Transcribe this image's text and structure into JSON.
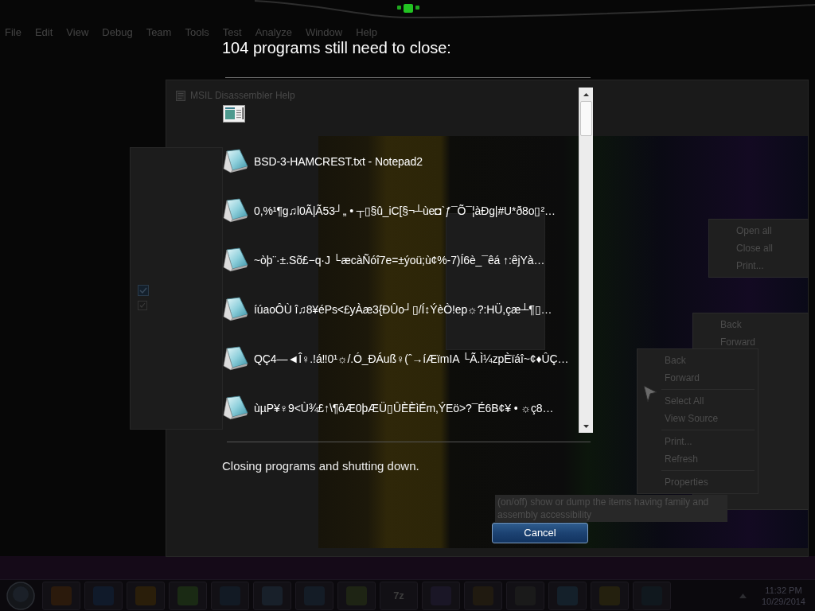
{
  "background": {
    "menu_bar": [
      "File",
      "Edit",
      "View",
      "Debug",
      "Team",
      "Tools",
      "Test",
      "Analyze",
      "Window",
      "Help"
    ],
    "help_window": {
      "title": "MSIL Disassembler Help"
    },
    "context_menus": [
      {
        "groups": [
          [
            "Open all",
            "Close all",
            "Print..."
          ]
        ]
      },
      {
        "groups": [
          [
            "Back",
            "Forward"
          ]
        ]
      },
      {
        "groups": [
          [
            "Back",
            "Forward"
          ],
          [
            "Select All",
            "View Source"
          ],
          [
            "Print...",
            "Refresh"
          ],
          [
            "Properties"
          ]
        ]
      }
    ],
    "tooltip": "(on/off) show or dump the items having family and assembly accessibility"
  },
  "taskbar": {
    "buttons": [
      {
        "kind": "orb"
      },
      {
        "kind": "app"
      },
      {
        "kind": "app"
      },
      {
        "kind": "app"
      },
      {
        "kind": "app"
      },
      {
        "kind": "app"
      },
      {
        "kind": "app"
      },
      {
        "kind": "app"
      },
      {
        "kind": "app"
      },
      {
        "kind": "label",
        "label": "7z"
      },
      {
        "kind": "app"
      },
      {
        "kind": "app"
      },
      {
        "kind": "app"
      },
      {
        "kind": "app"
      },
      {
        "kind": "app"
      },
      {
        "kind": "app"
      }
    ],
    "clock": {
      "time": "11:32 PM",
      "date": "10/29/2014"
    }
  },
  "shutdown": {
    "title": "104 programs still need to close:",
    "programs": [
      {
        "kind": "window"
      },
      {
        "kind": "notepad",
        "title": "BSD-3-HAMCREST.txt - Notepad2"
      },
      {
        "kind": "notepad",
        "title": "0,%¹¶g♫l0Ã|Ã53┘„ • ┬▯§û_iC[§¬┴ùe◘`ƒ¯Õ¯¦àÐg|#U*ð8o▯²…"
      },
      {
        "kind": "notepad",
        "title": "~òþ¨·±.Sõ£−q·J └æcàÑóî7e=±ýoü;ù¢%-7)Í6è_¯êá ↑:êjYà…"
      },
      {
        "kind": "notepad",
        "title": "íúaoÔÙ î♫8¥éPs<£yÀæ3{ÐÛo┘▯/Í↕ÝèÒ!ep☼?:HÜ,çæ┴¶▯…"
      },
      {
        "kind": "notepad",
        "title": "QÇ4—◄Î♀.!á‼0¹☼/.Ó_ÐÁuß♀(ˆ→íÆïmIA └Ã.Ì¼zpÈïáî~¢♦ÛÇ…"
      },
      {
        "kind": "notepad",
        "title": "ùµP¥♀9<Ù¾£↑\\¶ôÆ0þÆÜ▯ÛÈÈìÉm,ÝEö>?¯É6B¢¥ • ☼ç8…"
      }
    ],
    "status": "Closing programs and shutting down.",
    "buttons": [
      "Cancel"
    ]
  }
}
